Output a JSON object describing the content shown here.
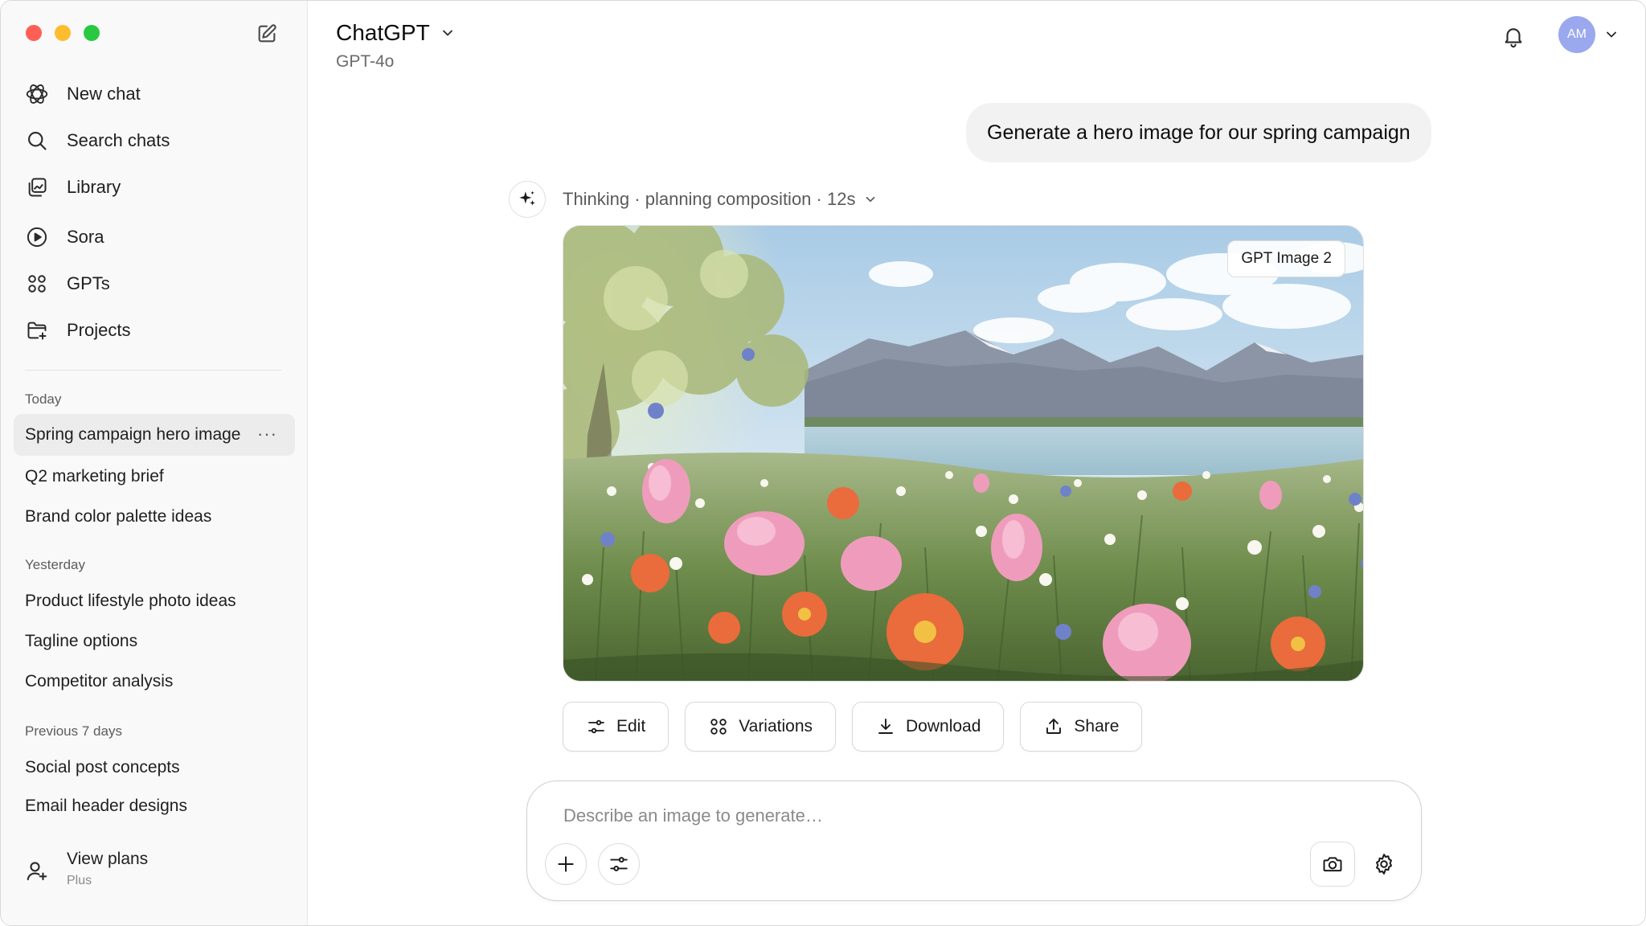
{
  "window": {
    "controls": [
      "close",
      "minimize",
      "maximize"
    ]
  },
  "sidebar": {
    "compose_icon": "compose-icon",
    "nav": [
      {
        "label": "New chat",
        "icon": "openai-logo-icon"
      },
      {
        "label": "Search chats",
        "icon": "search-icon"
      },
      {
        "label": "Library",
        "icon": "library-icon"
      },
      {
        "label": "Sora",
        "icon": "play-circle-icon"
      },
      {
        "label": "GPTs",
        "icon": "grid-icon"
      },
      {
        "label": "Projects",
        "icon": "folder-plus-icon"
      }
    ],
    "groups": [
      {
        "label": "Today",
        "chats": [
          {
            "title": "Spring campaign hero image",
            "active": true,
            "more": "···"
          },
          {
            "title": "Q2 marketing brief"
          },
          {
            "title": "Brand color palette ideas"
          }
        ]
      },
      {
        "label": "Yesterday",
        "chats": [
          {
            "title": "Product lifestyle photo ideas"
          },
          {
            "title": "Tagline options"
          },
          {
            "title": "Competitor analysis"
          }
        ]
      },
      {
        "label": "Previous 7 days",
        "chats": [
          {
            "title": "Social post concepts"
          },
          {
            "title": "Email header designs"
          }
        ]
      }
    ],
    "footer": {
      "title": "View plans",
      "subtitle": "Plus",
      "icon": "user-plus-icon"
    }
  },
  "header": {
    "title": "ChatGPT",
    "model": "GPT-4o",
    "bell_icon": "bell-icon",
    "avatar_initials": "AM",
    "avatar_color": "#9aa8ee"
  },
  "conversation": {
    "user_message": "Generate a hero image for our spring campaign",
    "thinking": {
      "label": "Thinking",
      "detail": "planning composition",
      "duration": "12s"
    },
    "image": {
      "badge": "GPT Image 2",
      "alt": "Spring meadow with tulips, mountains and lake"
    },
    "actions": [
      {
        "label": "Edit",
        "icon": "sliders-icon"
      },
      {
        "label": "Variations",
        "icon": "grid-icon"
      },
      {
        "label": "Download",
        "icon": "download-icon"
      },
      {
        "label": "Share",
        "icon": "share-icon"
      }
    ]
  },
  "composer": {
    "placeholder": "Describe an image to generate…",
    "left_buttons": [
      "plus-icon",
      "sliders-icon"
    ],
    "right_buttons": [
      "camera-icon",
      "gear-icon"
    ]
  }
}
